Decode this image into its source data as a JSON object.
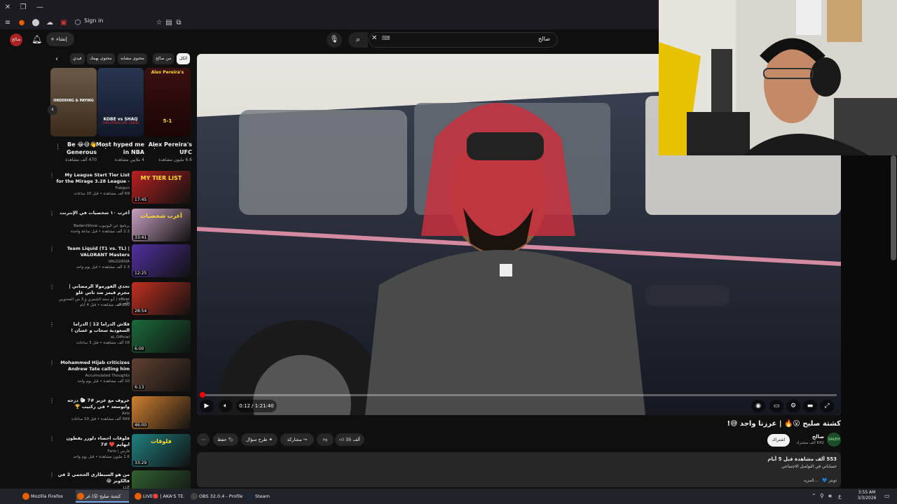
{
  "browser": {
    "sign_in": "Sign in"
  },
  "header": {
    "create_label": "إنشاء",
    "search_value": "صالح",
    "avatar_text": "صالح"
  },
  "chips": [
    "الكل",
    "من صالح",
    "محتوى مشابه",
    "محتوى يهمك",
    "فيدي"
  ],
  "shelf": [
    {
      "title": "Alex Pereira's UFC",
      "views": "6.6 مليون مشاهدة",
      "thumb_text": "Alex Pereira's",
      "thumb_sub": "5-1",
      "color": "#3a1010"
    },
    {
      "title": "Most hyped me in NBA",
      "views": "4 ملايين مشاهدة",
      "thumb_text": "KOBE vs SHAQ",
      "thumb_sub": "CHRISTMAS DAY (2004)",
      "color": "#2a3550"
    },
    {
      "title": "Be 😂😅👋 Generous",
      "views": "470 ألف مشاهدة",
      "thumb_text": "ORDERING & PAYING",
      "thumb_sub": "",
      "color": "#5a4a3a"
    }
  ],
  "side_videos": [
    {
      "title": "My League Start Tier List for the Mirage 3.28 League - Path of",
      "channel": "Fubgun",
      "meta": "69 ألف مشاهدة • قبل 10 ساعات",
      "duration": "17:45",
      "thumb": "MY TIER LIST",
      "color": "#b82020"
    },
    {
      "title": "أغرب ١٠ شخصيات في الإنترنت",
      "channel": "برنامج عن اليوتيوب BadersShow",
      "meta": "2.2 ألف مشاهدة • قبل ساعة واحدة",
      "duration": "33:41",
      "thumb": "أغرب شخصيات",
      "color": "#c8a0c0"
    },
    {
      "title": "Team Liquid (T1 vs. TL) | VALORANT Masters Santiago",
      "channel": "VALO2ASIA",
      "meta": "2.3 ألف مشاهدة • قبل يوم واحد",
      "duration": "12:25",
      "thumb": "",
      "color": "#5030a0"
    },
    {
      "title": "تحدي الفورمولا الرمضاني | مجرم قيمز ضد ناس غلو",
      "channel": "xBear | أبو سعد الشمري و 3 من المحتويين الآخرين",
      "meta": "390 ألف مشاهدة • قبل 4 أيام",
      "duration": "28:54",
      "thumb": "",
      "color": "#c03020"
    },
    {
      "title": "فلاش الدراما 12 | الدراما السعودية سحاب و غسان !",
      "channel": "aL Official",
      "meta": "16 ألف مشاهدة • قبل 3 ساعات",
      "duration": "6:00",
      "thumb": "",
      "color": "#1a6a3a"
    },
    {
      "title": "Mohammed Hijab criticizes Andrew Tate calling him an...",
      "channel": "Accumulated Thoughts",
      "meta": "10 ألف مشاهدة • قبل يوم واحد",
      "duration": "6:13",
      "thumb": "",
      "color": "#604030"
    },
    {
      "title": "خروف مع عزيز #7 🐑 درجه وابوسعد • في ركبيب 🏆 الموسم الثالث",
      "channel": "Aziz",
      "meta": "569 ألف مشاهدة • قبل 10 ساعات",
      "duration": "46:00",
      "thumb": "",
      "color": "#d08030"
    },
    {
      "title": "فلوقات احضاء دلوزر يقطون ابهايم ❤️ #7",
      "channel": "فارس | Faris",
      "meta": "1.6 مليون مشاهدة • قبل يوم واحد",
      "duration": "33:29",
      "thumb": "فلوقات",
      "color": "#208080"
    },
    {
      "title": "من هو السيطاري الحجمي 2 في فالكونز 😂",
      "channel": "LLE",
      "meta": "",
      "duration": "",
      "thumb": "",
      "color": "#306030"
    }
  ],
  "player": {
    "time": "0:12 / 1:21:40",
    "progress": 0.0025
  },
  "video": {
    "title": "كشتة صليح 😮🔥 | غرزنا واجد 😅!",
    "channel": "صالح",
    "subs": "642 ألف مشترك",
    "channel_logo": "SALEH",
    "subscribe": "اشتراك",
    "likes": "35 ألف",
    "share": "مشاركة",
    "ask": "طرح سؤال",
    "save": "حفظ",
    "stats": "553 ألف مشاهدة قبل 5 أيام",
    "desc": "حساباتي في التواصل الاجتماعي",
    "more": "...المزيد",
    "tag": "تويتر 💙"
  },
  "taskbar": {
    "apps": [
      {
        "label": "Mozilla Firefox",
        "color": "#e66000"
      },
      {
        "label": "كشتة صليح 😮| غر",
        "color": "#e66000"
      },
      {
        "label": "LIVE🔴 | AKA'S TE...",
        "color": "#e66000"
      },
      {
        "label": "OBS 32.0.4 - Profile:...",
        "color": "#444"
      },
      {
        "label": "Steam",
        "color": "#1b2838"
      }
    ],
    "time": "3:55 AM",
    "date": "3/3/2026"
  }
}
